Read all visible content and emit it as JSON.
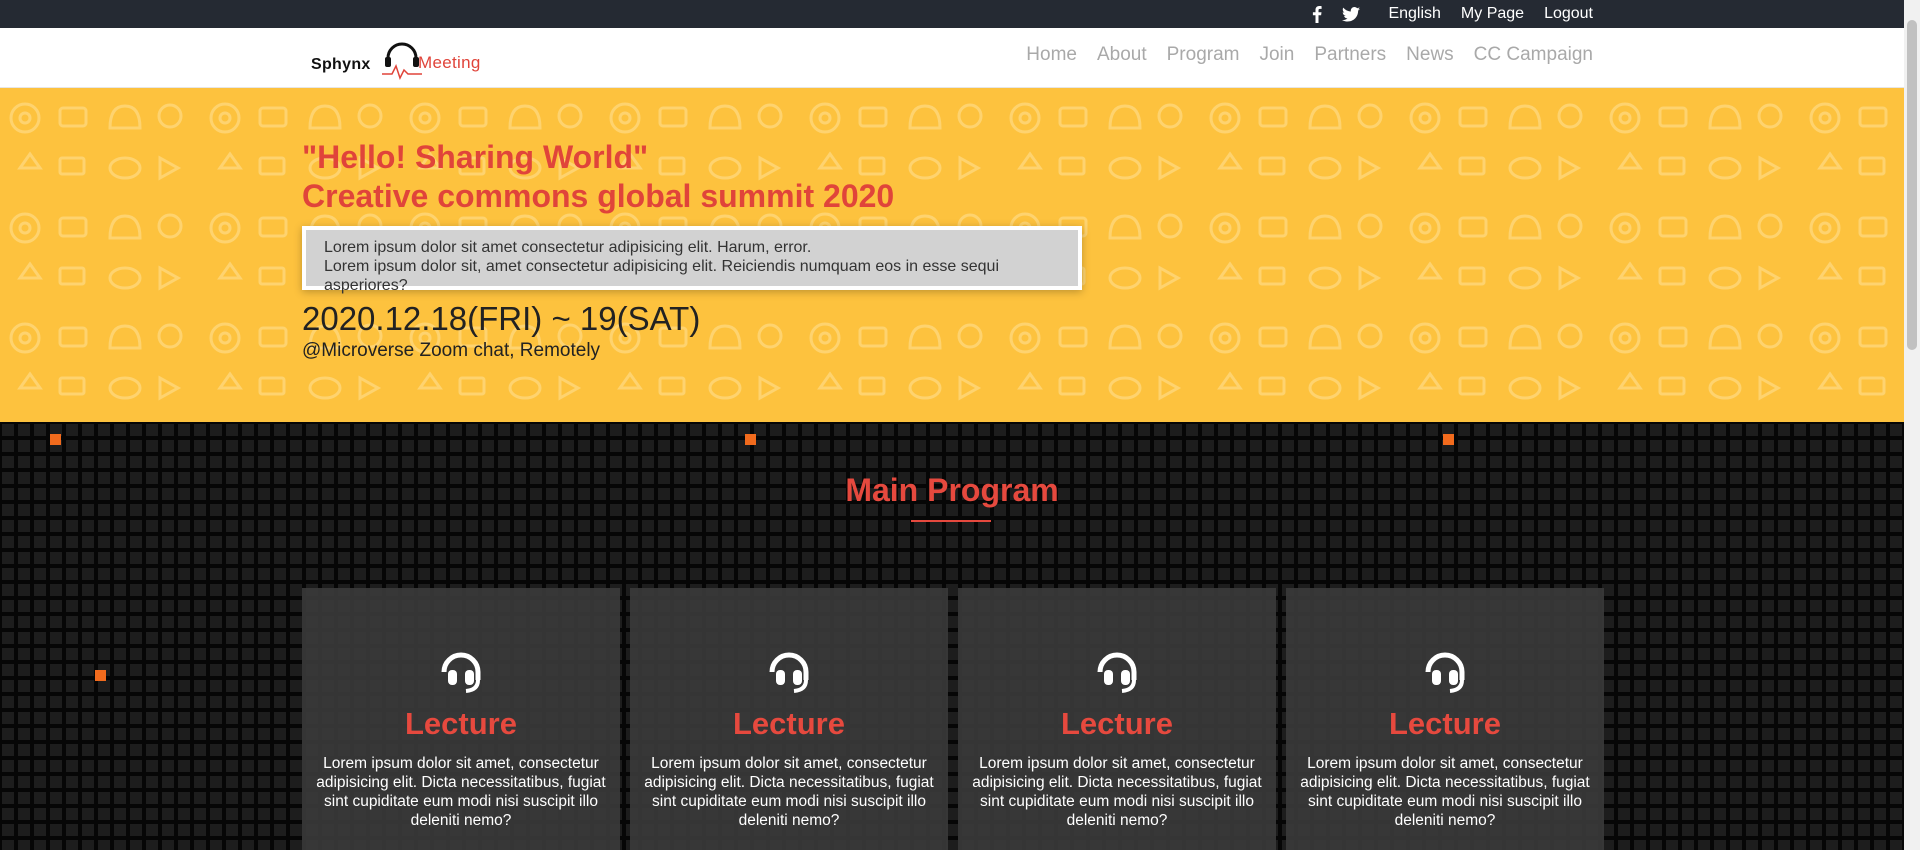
{
  "topbar": {
    "social": [
      "facebook-icon",
      "twitter-icon"
    ],
    "language": "English",
    "my_page": "My Page",
    "logout": "Logout"
  },
  "logo": {
    "word1": "Sphynx",
    "word2": "Meeting"
  },
  "nav": [
    "Home",
    "About",
    "Program",
    "Join",
    "Partners",
    "News",
    "CC Campaign"
  ],
  "hero": {
    "title_line1": "\"Hello! Sharing World\"",
    "title_line2": "Creative commons global summit 2020",
    "box_line1": "Lorem ipsum dolor sit amet consectetur adipisicing elit. Harum, error.",
    "box_line2": "Lorem ipsum dolor sit, amet consectetur adipisicing elit. Reiciendis numquam eos in esse sequi asperiores?",
    "date": "2020.12.18(FRI) ~ 19(SAT)",
    "location": "@Microverse Zoom chat, Remotely"
  },
  "program": {
    "title": "Main Program",
    "cards": [
      {
        "icon": "headset-icon",
        "title": "Lecture",
        "text": "Lorem ipsum dolor sit amet, consectetur adipisicing elit. Dicta necessitatibus, fugiat sint cupiditate eum modi nisi suscipit illo deleniti nemo?"
      },
      {
        "icon": "headset-icon",
        "title": "Lecture",
        "text": "Lorem ipsum dolor sit amet, consectetur adipisicing elit. Dicta necessitatibus, fugiat sint cupiditate eum modi nisi suscipit illo deleniti nemo?"
      },
      {
        "icon": "headset-icon",
        "title": "Lecture",
        "text": "Lorem ipsum dolor sit amet, consectetur adipisicing elit. Dicta necessitatibus, fugiat sint cupiditate eum modi nisi suscipit illo deleniti nemo?"
      },
      {
        "icon": "headset-icon",
        "title": "Lecture",
        "text": "Lorem ipsum dolor sit amet, consectetur adipisicing elit. Dicta necessitatibus, fugiat sint cupiditate eum modi nisi suscipit illo deleniti nemo?"
      }
    ]
  },
  "colors": {
    "accent": "#e0443a",
    "hero_bg": "#fdc23e",
    "topbar_bg": "#252a33",
    "nav_text": "#a9a9a9"
  }
}
